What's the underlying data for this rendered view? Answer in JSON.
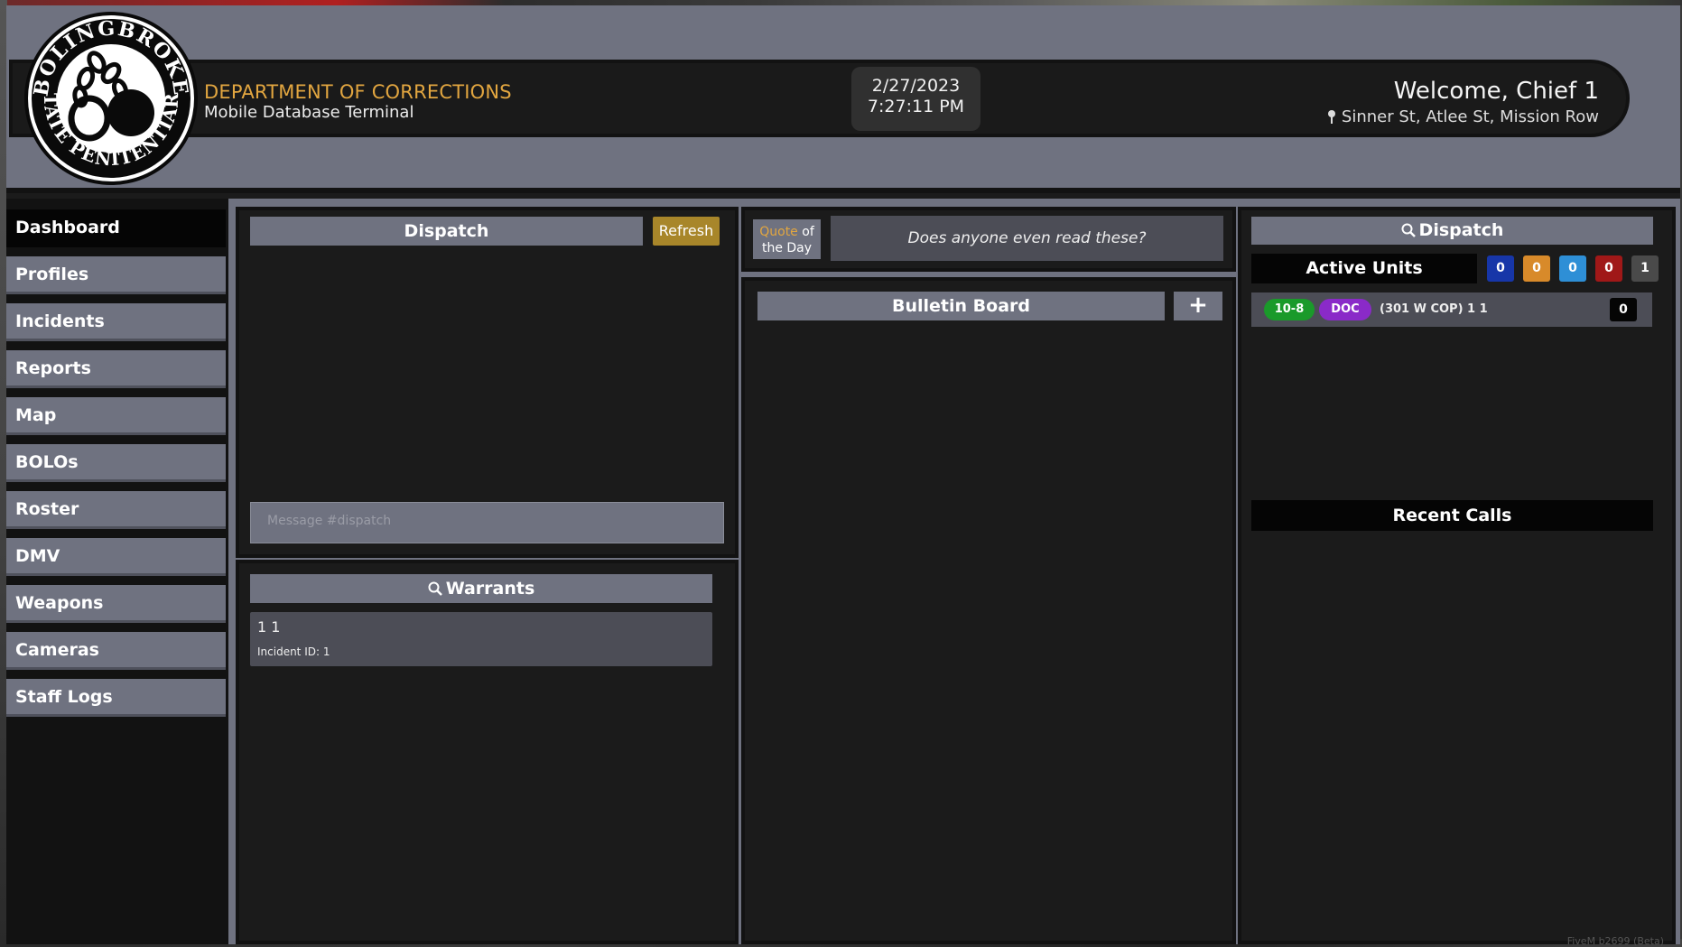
{
  "header": {
    "department": "DEPARTMENT OF CORRECTIONS",
    "subtitle": "Mobile Database Terminal",
    "date": "2/27/2023",
    "time": "7:27:11 PM",
    "welcome": "Welcome, Chief 1",
    "location": "Sinner St, Atlee St, Mission Row",
    "logo": {
      "top_text": "BOLINGBROKE",
      "bottom_text": "STATE PENITENTIARY",
      "icon": "ball-and-chain-icon"
    }
  },
  "sidebar": {
    "items": [
      {
        "label": "Dashboard",
        "active": true
      },
      {
        "label": "Profiles"
      },
      {
        "label": "Incidents"
      },
      {
        "label": "Reports"
      },
      {
        "label": "Map"
      },
      {
        "label": "BOLOs"
      },
      {
        "label": "Roster"
      },
      {
        "label": "DMV"
      },
      {
        "label": "Weapons"
      },
      {
        "label": "Cameras"
      },
      {
        "label": "Staff Logs"
      }
    ]
  },
  "dispatch_chat": {
    "title": "Dispatch",
    "refresh_label": "Refresh",
    "placeholder": "Message #dispatch"
  },
  "warrants": {
    "title": "Warrants",
    "items": [
      {
        "name": "1 1",
        "incident": "Incident ID: 1"
      }
    ]
  },
  "quote": {
    "label_word": "Quote",
    "label_of": "of",
    "label_day": "the Day",
    "text": "Does anyone even read these?"
  },
  "bulletin": {
    "title": "Bulletin Board",
    "add_label": "+"
  },
  "dispatch_units": {
    "title": "Dispatch",
    "active_units_label": "Active Units",
    "counts": [
      {
        "value": "0",
        "color": "#1736a8"
      },
      {
        "value": "0",
        "color": "#d88a2a"
      },
      {
        "value": "0",
        "color": "#2e8fd6"
      },
      {
        "value": "0",
        "color": "#a01818"
      },
      {
        "value": "1",
        "color": "#4a4a4a"
      }
    ],
    "units": [
      {
        "status": "10-8",
        "status_color": "#1a9a2a",
        "dept": "DOC",
        "dept_color": "#8a2ac8",
        "name": "(301 W COP) 1 1",
        "count": "0"
      }
    ],
    "recent_calls_label": "Recent Calls"
  },
  "watermark": "FiveM b2699 (Beta)"
}
